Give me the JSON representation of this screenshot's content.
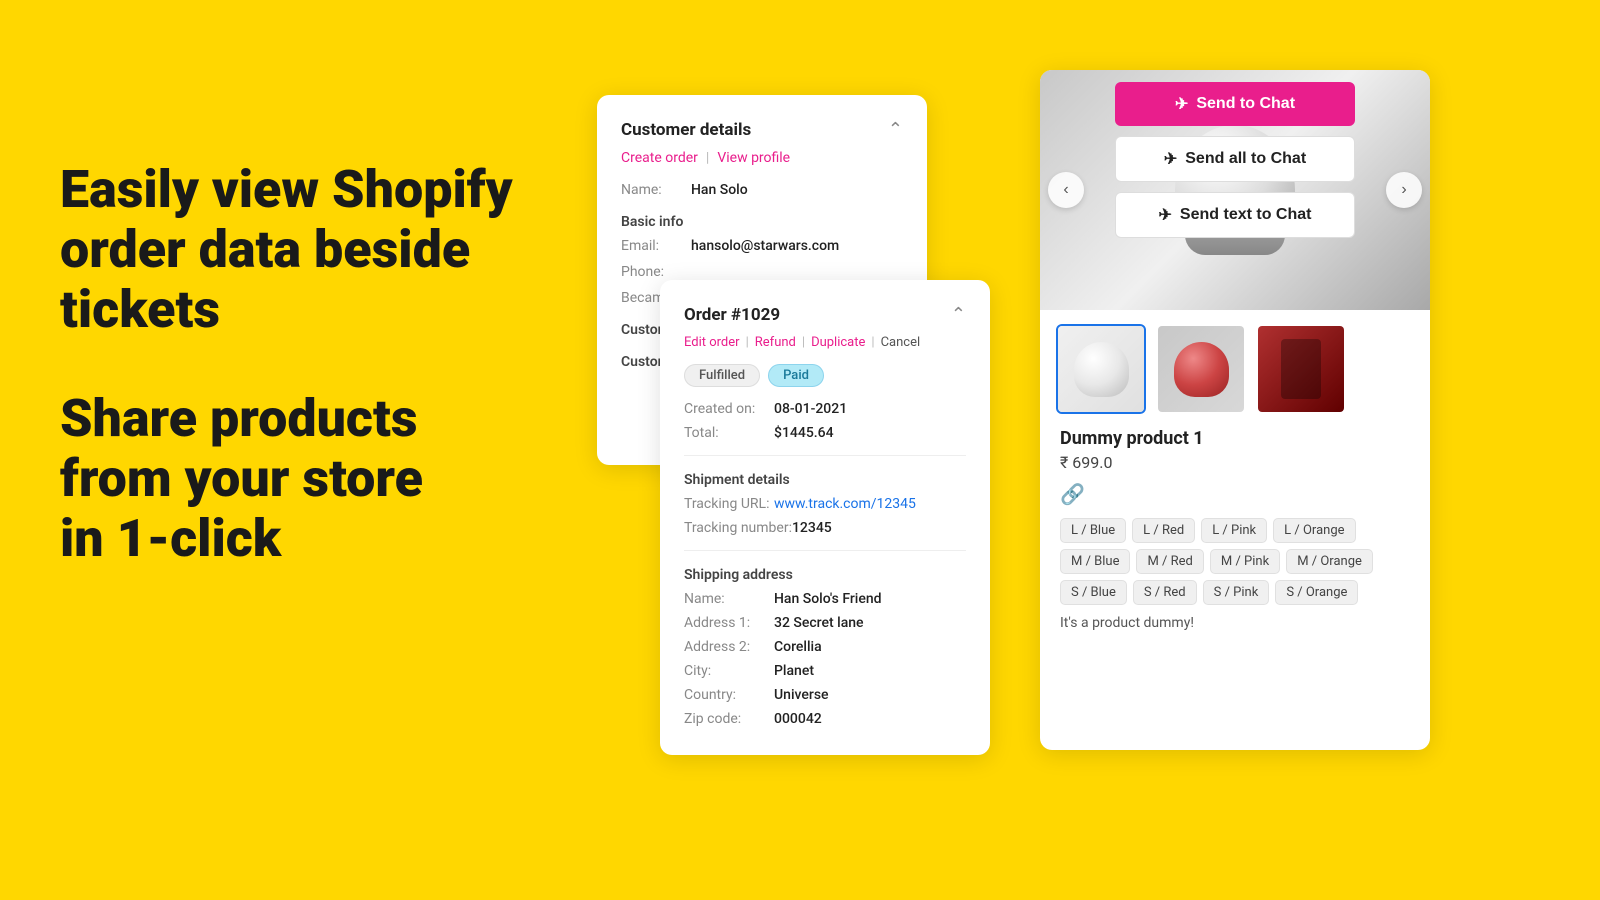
{
  "hero": {
    "line1": "Easily view Shopify",
    "line2": "order data beside",
    "line3": "tickets",
    "line4": "Share products",
    "line5": "from your store",
    "line6": "in 1-click"
  },
  "customer_card": {
    "title": "Customer details",
    "action_create": "Create order",
    "action_view": "View profile",
    "name_label": "Name:",
    "name_value": "Han Solo",
    "basic_info": "Basic info",
    "email_label": "Email:",
    "email_value": "hansolo@starwars.com",
    "phone_label": "Phone:",
    "became_label": "Became",
    "custom_label": "Custon",
    "custom2_label": "Custon"
  },
  "order_card": {
    "title": "Order #1029",
    "action_edit": "Edit order",
    "action_refund": "Refund",
    "action_duplicate": "Duplicate",
    "action_cancel": "Cancel",
    "badge_fulfilled": "Fulfilled",
    "badge_paid": "Paid",
    "created_label": "Created on:",
    "created_value": "08-01-2021",
    "total_label": "Total:",
    "total_value": "$1445.64",
    "shipment_title": "Shipment details",
    "tracking_url_label": "Tracking URL:",
    "tracking_url_value": "www.track.com/12345",
    "tracking_number_label": "Tracking number:",
    "tracking_number_value": "12345",
    "shipping_title": "Shipping address",
    "ship_name_label": "Name:",
    "ship_name_value": "Han Solo's Friend",
    "address1_label": "Address 1:",
    "address1_value": "32 Secret lane",
    "address2_label": "Address 2:",
    "address2_value": "Corellia",
    "city_label": "City:",
    "city_value": "Planet",
    "country_label": "Country:",
    "country_value": "Universe",
    "zip_label": "Zip code:",
    "zip_value": "000042"
  },
  "product_card": {
    "send_to_chat": "Send to Chat",
    "send_all_to_chat": "Send all to Chat",
    "send_text_to_chat": "Send text to Chat",
    "product_name": "Dummy product 1",
    "product_price": "₹ 699.0",
    "product_desc": "It's a product dummy!",
    "variants": [
      "L / Blue",
      "L / Red",
      "L / Pink",
      "L / Orange",
      "M / Blue",
      "M / Red",
      "M / Pink",
      "M / Orange",
      "S / Blue",
      "S / Red",
      "S / Pink",
      "S / Orange"
    ]
  }
}
